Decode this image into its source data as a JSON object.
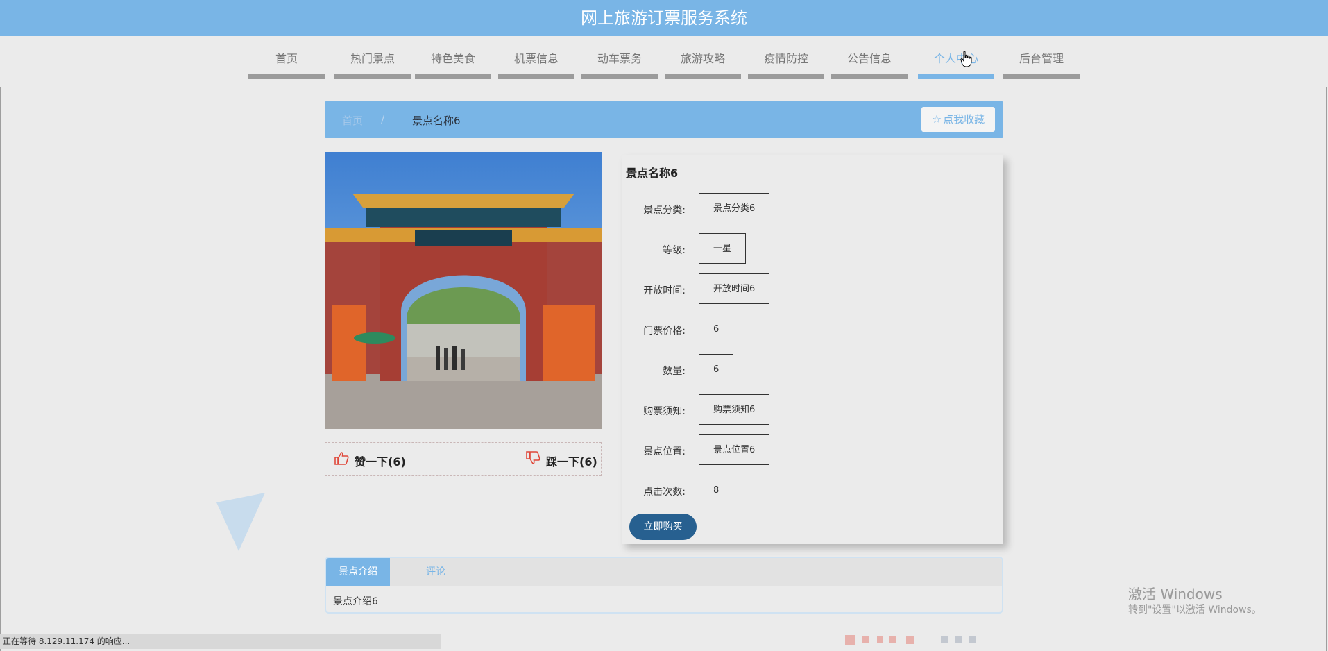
{
  "site": {
    "title": "网上旅游订票服务系统"
  },
  "nav": [
    {
      "label": "首页"
    },
    {
      "label": "热门景点"
    },
    {
      "label": "特色美食"
    },
    {
      "label": "机票信息"
    },
    {
      "label": "动车票务"
    },
    {
      "label": "旅游攻略"
    },
    {
      "label": "疫情防控"
    },
    {
      "label": "公告信息"
    },
    {
      "label": "个人中心",
      "active": true
    },
    {
      "label": "后台管理"
    }
  ],
  "breadcrumb": {
    "home": "首页",
    "separator": "/",
    "current": "景点名称6"
  },
  "favorite": {
    "label": "点我收藏",
    "icon": "star-outline-icon"
  },
  "likes": {
    "like_label": "赞一下(6)",
    "dislike_label": "踩一下(6)",
    "like_icon": "thumbs-up-icon",
    "dislike_icon": "thumbs-down-icon",
    "icon_color": "#e0483a"
  },
  "detail": {
    "title": "景点名称6",
    "fields": [
      {
        "label": "景点分类:",
        "value": "景点分类6"
      },
      {
        "label": "等级:",
        "value": "一星"
      },
      {
        "label": "开放时间:",
        "value": "开放时间6"
      },
      {
        "label": "门票价格:",
        "value": "6"
      },
      {
        "label": "数量:",
        "value": "6"
      },
      {
        "label": "购票须知:",
        "value": "购票须知6"
      },
      {
        "label": "景点位置:",
        "value": "景点位置6"
      },
      {
        "label": "点击次数:",
        "value": "8"
      }
    ],
    "buy_label": "立即购买"
  },
  "tabs": {
    "items": [
      {
        "label": "景点介绍",
        "active": true
      },
      {
        "label": "评论"
      }
    ],
    "content": "景点介绍6"
  },
  "status_bar": "正在等待 8.129.11.174 的响应...",
  "watermark": {
    "line1": "激活 Windows",
    "line2": "转到\"设置\"以激活 Windows。"
  },
  "colors": {
    "accent": "#79b5e6",
    "button": "#276090",
    "background": "#ebebeb"
  }
}
